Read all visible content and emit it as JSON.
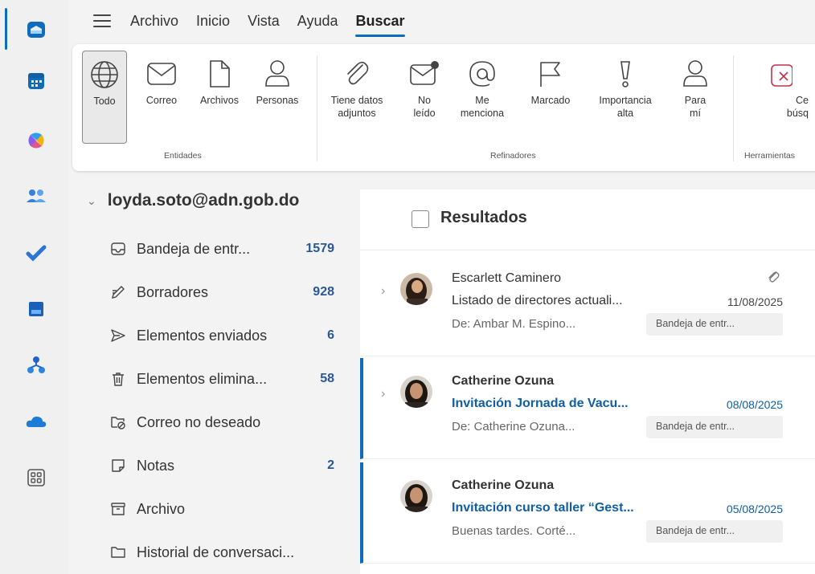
{
  "menubar": {
    "items": [
      "Archivo",
      "Inicio",
      "Vista",
      "Ayuda",
      "Buscar"
    ],
    "active": "Buscar"
  },
  "rail": {
    "icons": [
      "mail-icon",
      "calendar-icon",
      "copilot-icon",
      "people-icon",
      "todo-check-icon",
      "notebook-icon",
      "org-explorer-icon",
      "onedrive-cloud-icon",
      "apps-grid-icon"
    ]
  },
  "ribbon": {
    "entidades": {
      "group_label": "Entidades",
      "buttons": [
        "Todo",
        "Correo",
        "Archivos",
        "Personas"
      ]
    },
    "refinadores": {
      "group_label": "Refinadores",
      "buttons": [
        "Tiene datos\nadjuntos",
        "No\nleído",
        "Me\nmenciona",
        "Marcado",
        "Importancia\nalta",
        "Para\nmí"
      ]
    },
    "herramientas": {
      "group_label": "Herramientas",
      "buttons": [
        "Ce\nbúsq"
      ]
    }
  },
  "folders": {
    "account": "loyda.soto@adn.gob.do",
    "items": [
      {
        "label": "Bandeja de entr...",
        "count": "1579",
        "icon": "inbox-icon"
      },
      {
        "label": "Borradores",
        "count": "928",
        "icon": "drafts-pencil-icon"
      },
      {
        "label": "Elementos enviados",
        "count": "6",
        "icon": "send-icon"
      },
      {
        "label": "Elementos elimina...",
        "count": "58",
        "icon": "trash-icon"
      },
      {
        "label": "Correo no deseado",
        "count": "",
        "icon": "junk-folder-icon"
      },
      {
        "label": "Notas",
        "count": "2",
        "icon": "note-icon"
      },
      {
        "label": "Archivo",
        "count": "",
        "icon": "archive-icon"
      },
      {
        "label": "Historial de conversaci...",
        "count": "",
        "icon": "folder-icon"
      }
    ]
  },
  "list": {
    "title": "Resultados",
    "messages": [
      {
        "sender": "Escarlett Caminero",
        "subject": "Listado de directores actuali...",
        "date": "11/08/2025",
        "preview": "De: Ambar M. Espino...",
        "folder": "Bandeja de entr...",
        "unread": false,
        "attachment": true
      },
      {
        "sender": "Catherine Ozuna",
        "subject": "Invitación Jornada de Vacu...",
        "date": "08/08/2025",
        "preview": "De: Catherine Ozuna...",
        "folder": "Bandeja de entr...",
        "unread": true,
        "attachment": false
      },
      {
        "sender": "Catherine Ozuna",
        "subject": "Invitación curso taller “Gest...",
        "date": "05/08/2025",
        "preview": "Buenas tardes. Corté...",
        "folder": "Bandeja de entr...",
        "unread": true,
        "attachment": false
      }
    ]
  },
  "colors": {
    "accent": "#0f6cbd",
    "unread_text": "#115ea3",
    "count_text": "#2b5797"
  }
}
